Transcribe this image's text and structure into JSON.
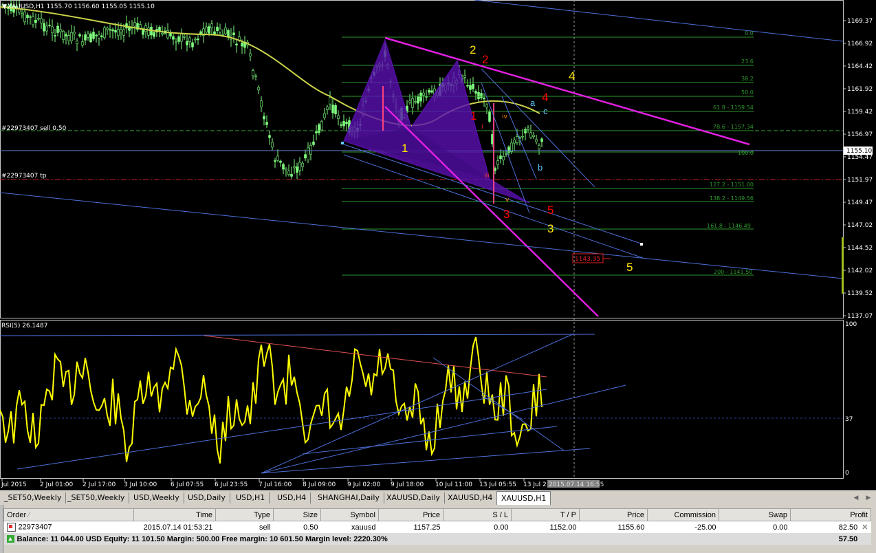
{
  "chart": {
    "title": "XAUUSD,H1  1155.70 1156.60 1155.05 1155.10",
    "price_axis": [
      "1169.37",
      "1166.92",
      "1164.42",
      "1161.92",
      "1159.42",
      "1156.97",
      "1154.47",
      "1151.97",
      "1149.47",
      "1147.02",
      "1144.52",
      "1142.02",
      "1139.52",
      "1137.07"
    ],
    "current_price_label": "1155.10",
    "sell_line_label": "#22973407 sell 0.50",
    "tp_line_label": "#22973407 tp",
    "price_box_label": "1143.35",
    "fib_levels": [
      "0.0",
      "23.6",
      "38.2",
      "50.0",
      "61.8 - 1159.54",
      "78.6 - 1157.34",
      "100.0",
      "127.2 - 1151.00",
      "138.2 - 1149.56",
      "161.8 - 1146.49",
      "200 - 1141.50"
    ],
    "wave_labels_yellow": [
      "1",
      "2",
      "3",
      "4",
      "5"
    ],
    "wave_labels_red": [
      "1",
      "2",
      "3",
      "4",
      "5"
    ],
    "sub_wave_labels": [
      "i",
      "iii",
      "iv",
      "v"
    ],
    "abc_labels": [
      "a",
      "b",
      "c"
    ],
    "colors": {
      "background": "#000000",
      "candles": "#7fff7f",
      "ma": "#cbd34a",
      "fib": "#2e9a2e",
      "channel": "#4c6fd8",
      "wave_yellow": "#ffe400",
      "wave_red": "#ff0000",
      "magenta": "#e020e0",
      "pattern": "#5a10b0",
      "rsi": "#ffff00"
    }
  },
  "rsi": {
    "title": "RSI(5) 26.1487",
    "axis": [
      "100",
      "37",
      "0"
    ]
  },
  "time_axis": [
    "Jul 2015",
    "2 Jul 01:00",
    "2 Jul 17:00",
    "3 Jul 10:00",
    "6 Jul 07:55",
    "6 Jul 23:55",
    "7 Jul 16:00",
    "8 Jul 09:00",
    "9 Jul 02:00",
    "9 Jul 18:00",
    "10 Jul 11:00",
    "13 Jul 05:55",
    "13 Jul 2"
  ],
  "crosshair_time": "2015.07.14 16:55",
  "tabs": [
    "_SET50,Weekly",
    "_SET50,Weekly",
    "USD,Weekly",
    "USD,Daily",
    "USD,H1",
    "USD,H4",
    "SHANGHAI,Daily",
    "XAUUSD,Daily",
    "XAUUSD,H4",
    "XAUUSD,H1"
  ],
  "active_tab": "XAUUSD,H1",
  "terminal": {
    "headers": [
      "Order",
      "Time",
      "Type",
      "Size",
      "Symbol",
      "Price",
      "S / L",
      "T / P",
      "Price",
      "Commission",
      "Swap",
      "Profit"
    ],
    "order": {
      "id": "22973407",
      "time": "2015.07.14 01:53:21",
      "type": "sell",
      "size": "0.50",
      "symbol": "xauusd",
      "price": "1157.25",
      "sl": "0.00",
      "tp": "1152.00",
      "current_price": "1155.60",
      "commission": "-25.00",
      "swap": "0.00",
      "profit": "82.50"
    },
    "balance_text": "Balance: 11 044.00 USD   Equity: 11 101.50   Margin: 500.00   Free margin: 10 601.50   Margin level: 2220.30%",
    "balance_profit": "57.50"
  }
}
